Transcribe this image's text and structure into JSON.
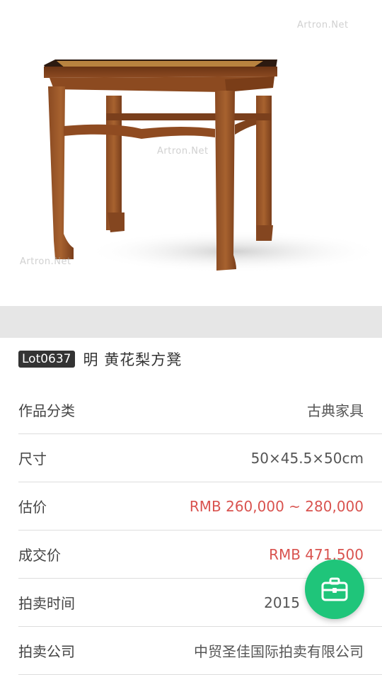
{
  "lot": {
    "badge": "Lot0637",
    "title": "明 黄花梨方凳"
  },
  "image": {
    "watermark": "Artron.Net"
  },
  "details": [
    {
      "label": "作品分类",
      "value": "古典家具",
      "highlight": false
    },
    {
      "label": "尺寸",
      "value": "50×45.5×50cm",
      "highlight": false
    },
    {
      "label": "估价",
      "value": "RMB 260,000 ~ 280,000",
      "highlight": true
    },
    {
      "label": "成交价",
      "value": "RMB 471,500",
      "highlight": true
    },
    {
      "label": "拍卖时间",
      "value": "2015",
      "highlight": false
    },
    {
      "label": "拍卖公司",
      "value": "中贸圣佳国际拍卖有限公司",
      "highlight": false
    }
  ],
  "fab": {
    "icon": "briefcase-icon"
  },
  "colors": {
    "price": "#d9534f",
    "fab": "#1fc57a",
    "badge": "#333333"
  }
}
